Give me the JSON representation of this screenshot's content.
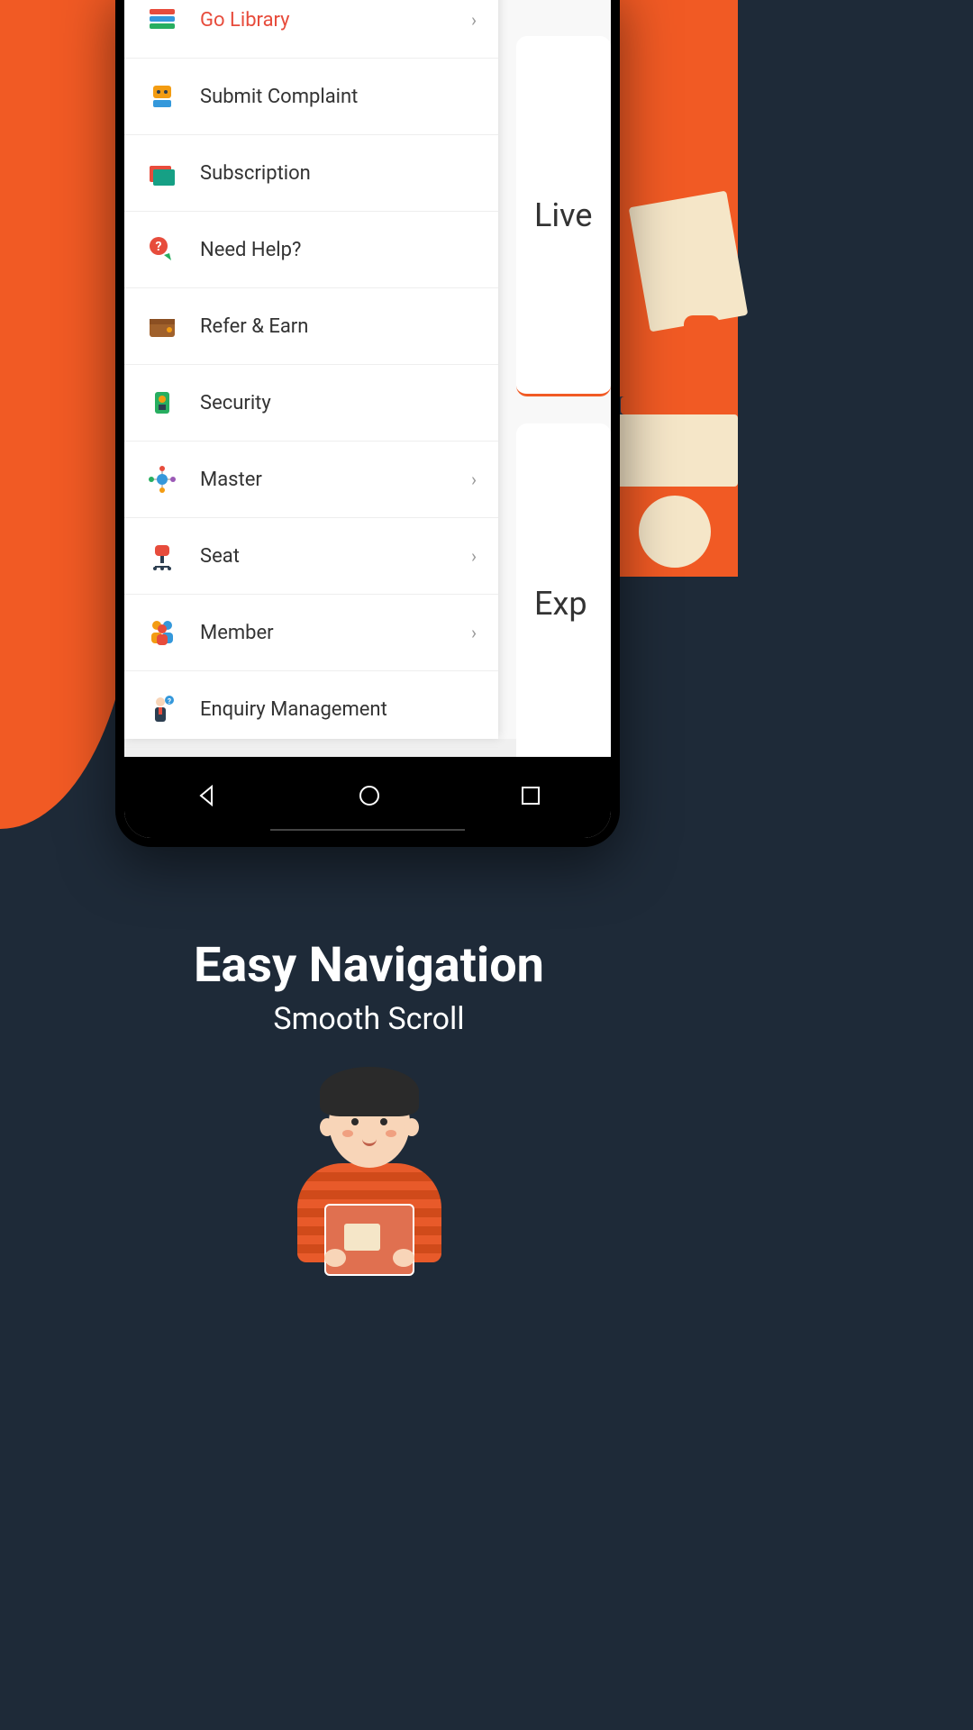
{
  "sidebar": {
    "items": [
      {
        "label": "Go Library",
        "active": true,
        "chevron": true,
        "icon": "books"
      },
      {
        "label": "Submit Complaint",
        "active": false,
        "chevron": false,
        "icon": "complaint"
      },
      {
        "label": "Subscription",
        "active": false,
        "chevron": false,
        "icon": "folder"
      },
      {
        "label": "Need Help?",
        "active": false,
        "chevron": false,
        "icon": "help"
      },
      {
        "label": "Refer & Earn",
        "active": false,
        "chevron": false,
        "icon": "wallet"
      },
      {
        "label": "Security",
        "active": false,
        "chevron": false,
        "icon": "security"
      },
      {
        "label": "Master",
        "active": false,
        "chevron": true,
        "icon": "master"
      },
      {
        "label": "Seat",
        "active": false,
        "chevron": true,
        "icon": "seat"
      },
      {
        "label": "Member",
        "active": false,
        "chevron": true,
        "icon": "member"
      },
      {
        "label": "Enquiry Management",
        "active": false,
        "chevron": false,
        "icon": "enquiry"
      }
    ]
  },
  "main": {
    "card1": "Live",
    "card2": "Exp"
  },
  "promo": {
    "title": "Easy Navigation",
    "subtitle": "Smooth Scroll"
  },
  "chevron_glyph": "›"
}
